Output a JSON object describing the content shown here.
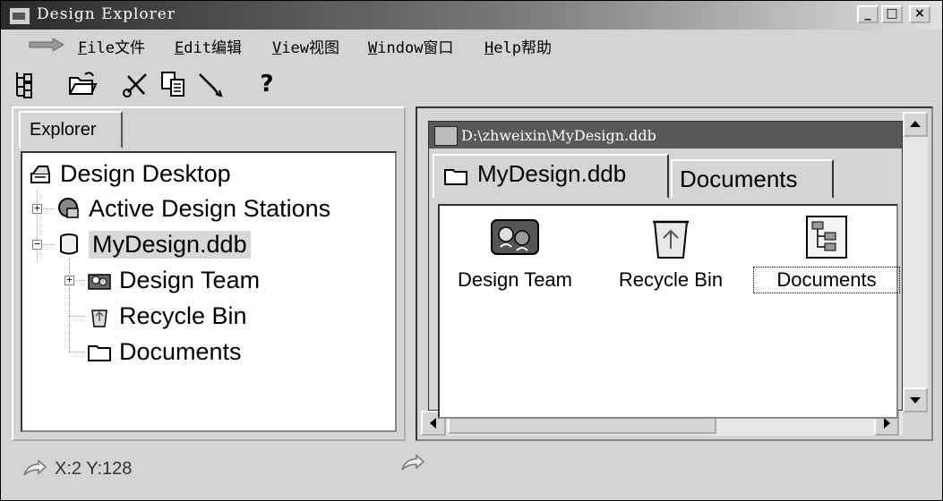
{
  "window": {
    "title": "Design Explorer"
  },
  "title_buttons": {
    "minimize": "_",
    "maximize": "□",
    "close": "×"
  },
  "menu": [
    {
      "mnemonic": "F",
      "rest": "ile文件"
    },
    {
      "mnemonic": "E",
      "rest": "dit编辑"
    },
    {
      "mnemonic": "V",
      "rest": "iew视图"
    },
    {
      "mnemonic": "W",
      "rest": "indow窗口"
    },
    {
      "mnemonic": "H",
      "rest": "elp帮助"
    }
  ],
  "toolbar": {
    "icons": [
      "explorer-tree-icon",
      "open-folder-icon",
      "cut-scissors-icon",
      "copy-icon",
      "paste-icon",
      "help-icon"
    ],
    "help_label": "?"
  },
  "explorer_tab": "Explorer",
  "tree": [
    {
      "label": "Design Desktop",
      "icon": "design-desktop-icon"
    },
    {
      "label": "Active Design Stations",
      "icon": "design-stations-icon",
      "expander": "+"
    },
    {
      "label": "MyDesign.ddb",
      "icon": "database-icon",
      "expander": "−",
      "selected": true
    },
    {
      "label": "Design Team",
      "icon": "design-team-icon",
      "expander": "+"
    },
    {
      "label": "Recycle Bin",
      "icon": "recycle-bin-icon"
    },
    {
      "label": "Documents",
      "icon": "folder-icon"
    }
  ],
  "doc_window": {
    "path": "D:\\zhweixin\\MyDesign.ddb",
    "tabs": [
      "MyDesign.ddb",
      "Documents"
    ],
    "items": [
      {
        "label": "Design Team",
        "icon": "design-team-icon"
      },
      {
        "label": "Recycle Bin",
        "icon": "recycle-bin-icon"
      },
      {
        "label": "Documents",
        "icon": "documents-icon",
        "focused": true
      }
    ]
  },
  "status": {
    "coords": "X:2 Y:128"
  }
}
